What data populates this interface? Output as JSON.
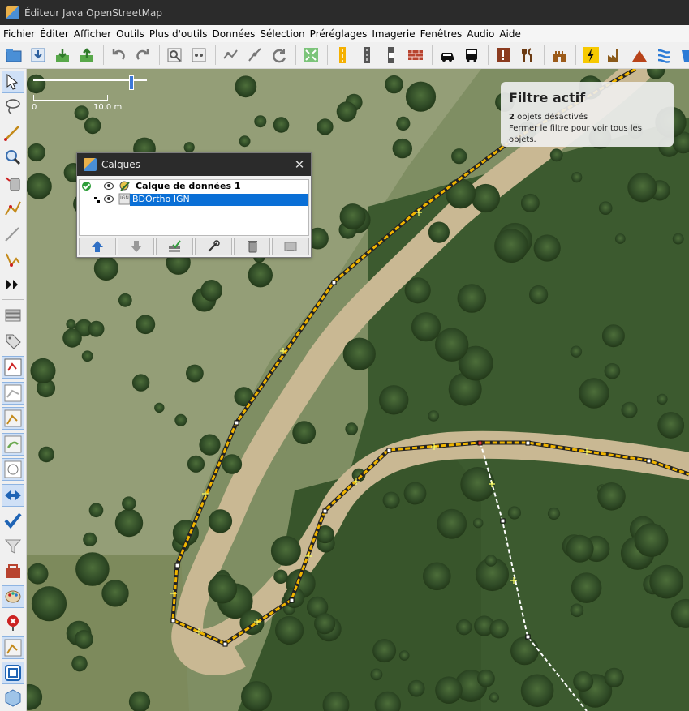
{
  "window": {
    "title": "Éditeur Java OpenStreetMap"
  },
  "menubar": [
    {
      "label": "Fichier"
    },
    {
      "label": "Éditer"
    },
    {
      "label": "Afficher"
    },
    {
      "label": "Outils"
    },
    {
      "label": "Plus d'outils"
    },
    {
      "label": "Données"
    },
    {
      "label": "Sélection"
    },
    {
      "label": "Préréglages"
    },
    {
      "label": "Imagerie"
    },
    {
      "label": "Fenêtres"
    },
    {
      "label": "Audio"
    },
    {
      "label": "Aide"
    }
  ],
  "toolbar": {
    "icons": [
      "open-icon",
      "download-icon",
      "download-data-icon",
      "upload-icon",
      "undo-icon",
      "redo-icon",
      "preferences-icon",
      "validate-icon",
      "merge-nodes-icon",
      "split-way-icon",
      "refresh-icon",
      "zoom-fit-icon",
      "tertiary-road-icon",
      "track-icon",
      "barrier-icon",
      "wall-icon",
      "car-icon",
      "bus-icon",
      "info-point-icon",
      "restaurant-icon",
      "castle-icon",
      "power-icon",
      "industrial-icon",
      "peak-icon",
      "waterway-icon",
      "water-icon"
    ]
  },
  "left_tools": [
    "select-icon",
    "lasso-icon",
    "draw-icon",
    "zoom-icon",
    "delete-icon",
    "improve-way-icon",
    "parallel-icon",
    "extrude-icon",
    "more-icon",
    "layers-icon",
    "tags-icon",
    "relation-icon",
    "selection-list-icon",
    "author-icon",
    "history-icon",
    "minimap-icon",
    "conflict-icon",
    "validation-icon",
    "filter-icon",
    "notes-icon",
    "paint-icon",
    "changeset-icon",
    "gpx-icon",
    "wireframe-icon",
    "3d-icon"
  ],
  "map": {
    "scale": {
      "zero_label": "0",
      "max_label": "10.0 m"
    },
    "filter": {
      "title": "Filtre actif",
      "count": "2",
      "line1_suffix": " objets désactivés",
      "line2": "Fermer le filtre pour voir tous les objets."
    }
  },
  "layers_panel": {
    "title": "Calques",
    "close_glyph": "✕",
    "layers": [
      {
        "name": "Calque de données 1",
        "active": true,
        "visible": true
      },
      {
        "name": "BDOrtho IGN",
        "active": false,
        "visible": true
      }
    ],
    "buttons": [
      "move-up-icon",
      "move-down-icon",
      "activate-layer-icon",
      "layer-properties-icon",
      "delete-layer-icon",
      "merge-layer-icon"
    ]
  },
  "colors": {
    "track": "#f0b400",
    "accent": "#0a6fd6",
    "titlebar": "#2b2b2b"
  }
}
